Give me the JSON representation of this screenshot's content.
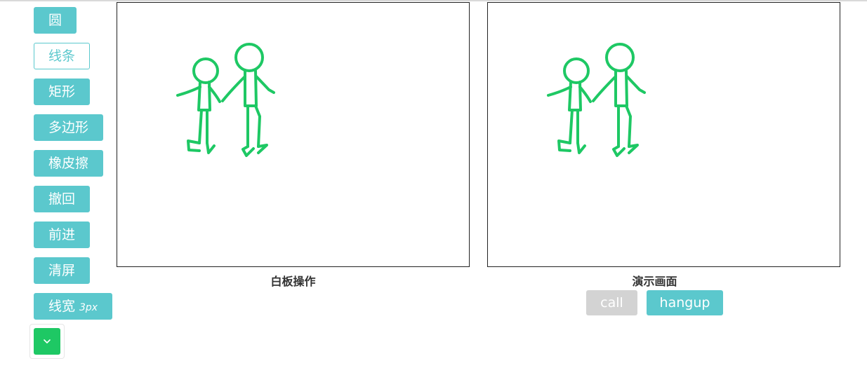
{
  "toolbar": {
    "circle_label": "圆",
    "line_label": "线条",
    "rect_label": "矩形",
    "polygon_label": "多边形",
    "eraser_label": "橡皮擦",
    "undo_label": "撤回",
    "redo_label": "前进",
    "clear_label": "清屏",
    "width_label": "线宽",
    "width_value": "3px",
    "stroke_color": "#1ec864"
  },
  "whiteboard": {
    "caption": "白板操作"
  },
  "preview": {
    "caption": "演示画面"
  },
  "call": {
    "call_label": "call",
    "hangup_label": "hangup"
  },
  "colors": {
    "accent": "#5bc8cd",
    "disabled": "#d3d3d3",
    "stroke": "#1ec864"
  }
}
